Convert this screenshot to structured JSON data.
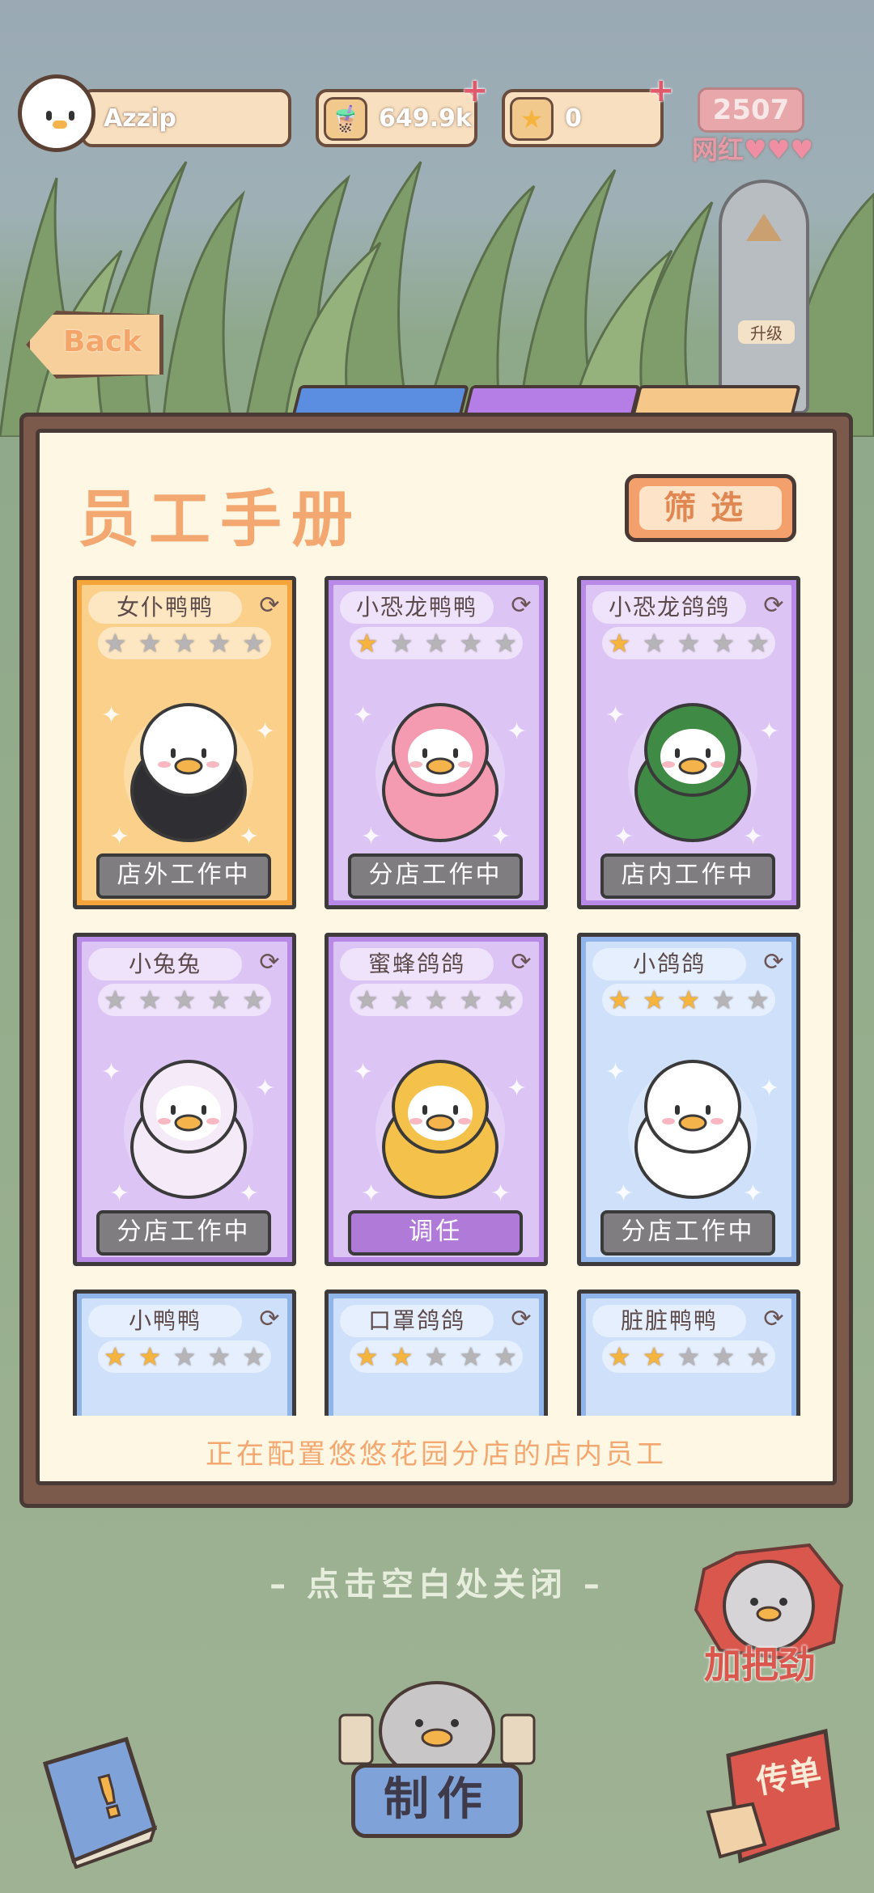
{
  "header": {
    "player_name": "Azzip",
    "tea_count": "649.9k",
    "star_count": "0",
    "fame_value": "2507",
    "fame_label": "网红",
    "upgrade_label": "升级"
  },
  "nav": {
    "back_label": "Back"
  },
  "panel": {
    "title": "员工手册",
    "filter_label": "筛选",
    "caption": "正在配置悠悠花园分店的店内员工",
    "tabs": [
      {
        "color": "#5b8de0"
      },
      {
        "color": "#b57ee6"
      },
      {
        "color": "#f5c889"
      }
    ]
  },
  "cards": [
    {
      "name": "女仆鸭鸭",
      "stars": 0,
      "status": "店外工作中",
      "theme": "orange",
      "creature": "maid-duck"
    },
    {
      "name": "小恐龙鸭鸭",
      "stars": 1,
      "status": "分店工作中",
      "theme": "purple",
      "creature": "pink-dino-duck"
    },
    {
      "name": "小恐龙鸽鸽",
      "stars": 1,
      "status": "店内工作中",
      "theme": "purple",
      "creature": "green-dino-pigeon"
    },
    {
      "name": "小兔兔",
      "stars": 0,
      "status": "分店工作中",
      "theme": "purple",
      "creature": "bunny"
    },
    {
      "name": "蜜蜂鸽鸽",
      "stars": 0,
      "status": "调任",
      "theme": "purple",
      "creature": "bee-pigeon"
    },
    {
      "name": "小鸽鸽",
      "stars": 3,
      "status": "分店工作中",
      "theme": "blue",
      "creature": "pigeon"
    },
    {
      "name": "小鸭鸭",
      "stars": 2,
      "status": "",
      "theme": "blue",
      "creature": "duck"
    },
    {
      "name": "口罩鸽鸽",
      "stars": 2,
      "status": "",
      "theme": "blue",
      "creature": "mask-pigeon"
    },
    {
      "name": "脏脏鸭鸭",
      "stars": 2,
      "status": "",
      "theme": "blue",
      "creature": "dirty-duck"
    }
  ],
  "footer": {
    "close_hint": "– 点击空白处关闭 –",
    "cheer_label": "加把劲",
    "make_label": "制作",
    "flyer_label": "传单"
  },
  "colors": {
    "orange_card": "#f5a43c",
    "purple_card": "#b889e6",
    "blue_card": "#8fb5ea",
    "accent_text": "#f4a871"
  }
}
